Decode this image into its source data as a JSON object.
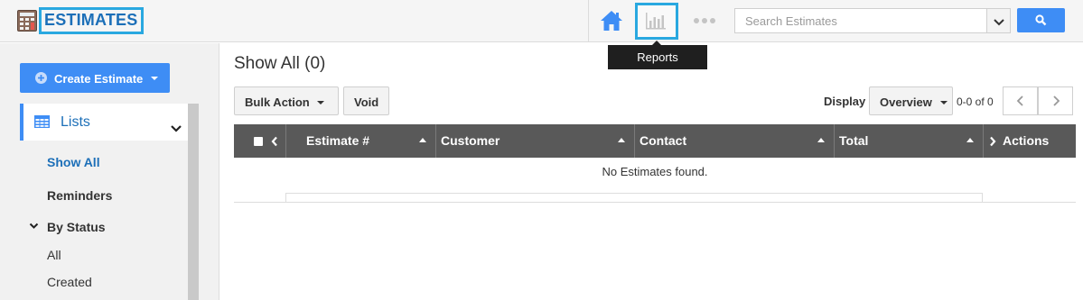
{
  "header": {
    "title": "ESTIMATES",
    "app_icon": "calculator-icon",
    "nav_icons": [
      "home-icon",
      "reports-chart-icon",
      "more-dots-icon"
    ],
    "search": {
      "placeholder": "Search Estimates",
      "value": ""
    },
    "tooltip": "Reports"
  },
  "sidebar": {
    "create_button": "Create Estimate",
    "lists_label": "Lists",
    "items": [
      {
        "label": "Show All"
      },
      {
        "label": "Reminders"
      },
      {
        "label": "By Status"
      },
      {
        "label": "All"
      },
      {
        "label": "Created"
      }
    ]
  },
  "main": {
    "title": "Show All (0)",
    "toolbar": {
      "bulk_action": "Bulk Action",
      "void": "Void",
      "display_label": "Display",
      "view_select": "Overview",
      "page_count": "0-0 of 0"
    },
    "table": {
      "columns": [
        "Estimate #",
        "Customer",
        "Contact",
        "Total",
        "Actions"
      ],
      "empty_message": "No Estimates found."
    }
  },
  "colors": {
    "accent": "#3e8df5",
    "highlight_box": "#29a8e0",
    "title_blue": "#1c6fb8",
    "table_header": "#595959"
  }
}
